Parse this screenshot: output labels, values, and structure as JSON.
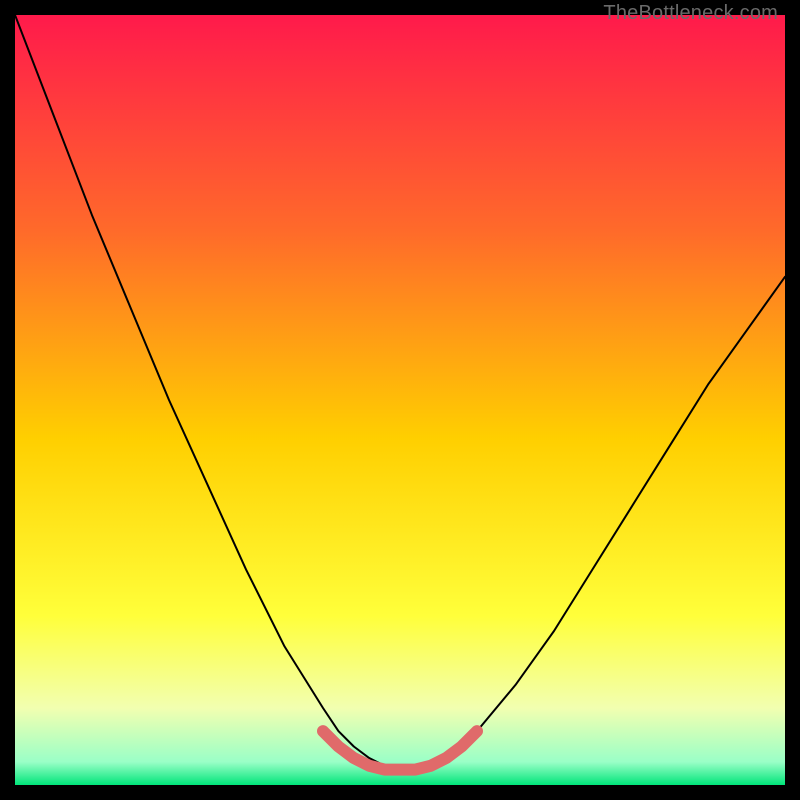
{
  "watermark": "TheBottleneck.com",
  "chart_data": {
    "type": "line",
    "title": "",
    "xlabel": "",
    "ylabel": "",
    "xlim": [
      0,
      100
    ],
    "ylim": [
      0,
      100
    ],
    "background_gradient": {
      "top": "#ff1a4b",
      "mid_upper": "#ff7a2a",
      "mid": "#ffe600",
      "mid_lower": "#f6ff8a",
      "bottom": "#00e57a"
    },
    "series": [
      {
        "name": "black-curve",
        "color": "#000000",
        "stroke_width_px": 2,
        "x": [
          0,
          5,
          10,
          15,
          20,
          25,
          30,
          35,
          40,
          42,
          44,
          46,
          48,
          50,
          52,
          54,
          56,
          58,
          60,
          65,
          70,
          75,
          80,
          85,
          90,
          95,
          100
        ],
        "values": [
          100,
          87,
          74,
          62,
          50,
          39,
          28,
          18,
          10,
          7,
          5,
          3.5,
          2.5,
          2,
          2,
          2.5,
          3.5,
          5,
          7,
          13,
          20,
          28,
          36,
          44,
          52,
          59,
          66
        ]
      },
      {
        "name": "pink-bottom-mark",
        "color": "#e06a6a",
        "stroke_width_px": 12,
        "x": [
          40,
          42,
          44,
          46,
          48,
          50,
          52,
          54,
          56,
          58,
          60
        ],
        "values": [
          7,
          5,
          3.5,
          2.5,
          2,
          2,
          2,
          2.5,
          3.5,
          5,
          7
        ]
      }
    ]
  }
}
